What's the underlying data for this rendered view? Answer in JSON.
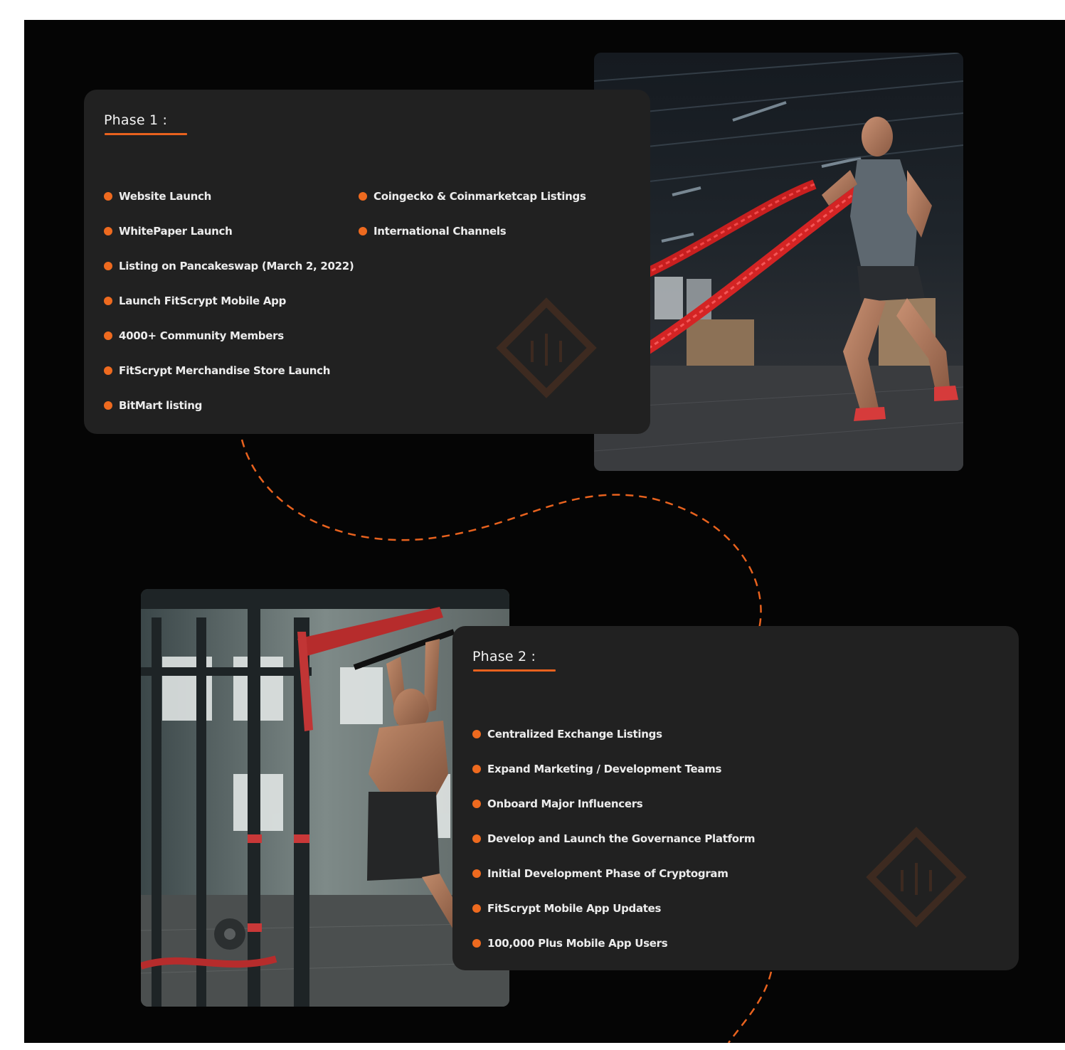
{
  "theme": {
    "background": "#050505",
    "card_background": "#212121",
    "accent": "#ee6a1f",
    "text": "#ececec"
  },
  "phases": [
    {
      "title": "Phase 1 :",
      "column_a": [
        "Website Launch",
        "WhitePaper Launch",
        "Listing on Pancakeswap (March 2, 2022)",
        "Launch FitScrypt Mobile App",
        "4000+ Community Members",
        "FitScrypt Merchandise Store Launch",
        "BitMart listing"
      ],
      "column_b": [
        "Coingecko & Coinmarketcap Listings",
        "International Channels"
      ],
      "photo": "battle-ropes-workout-photo"
    },
    {
      "title": "Phase 2 :",
      "column_a": [
        "Centralized Exchange Listings",
        "Expand Marketing / Development Teams",
        "Onboard Major Influencers",
        "Develop and Launch the Governance Platform",
        "Initial Development Phase of Cryptogram",
        "FitScrypt Mobile App Updates",
        "100,000 Plus Mobile App Users"
      ],
      "photo": "pull-up-bar-workout-photo"
    }
  ],
  "icons": {
    "bullet": "orange-dot-icon",
    "watermark": "diamond-logo-icon",
    "connector": "dashed-curve-connector"
  }
}
